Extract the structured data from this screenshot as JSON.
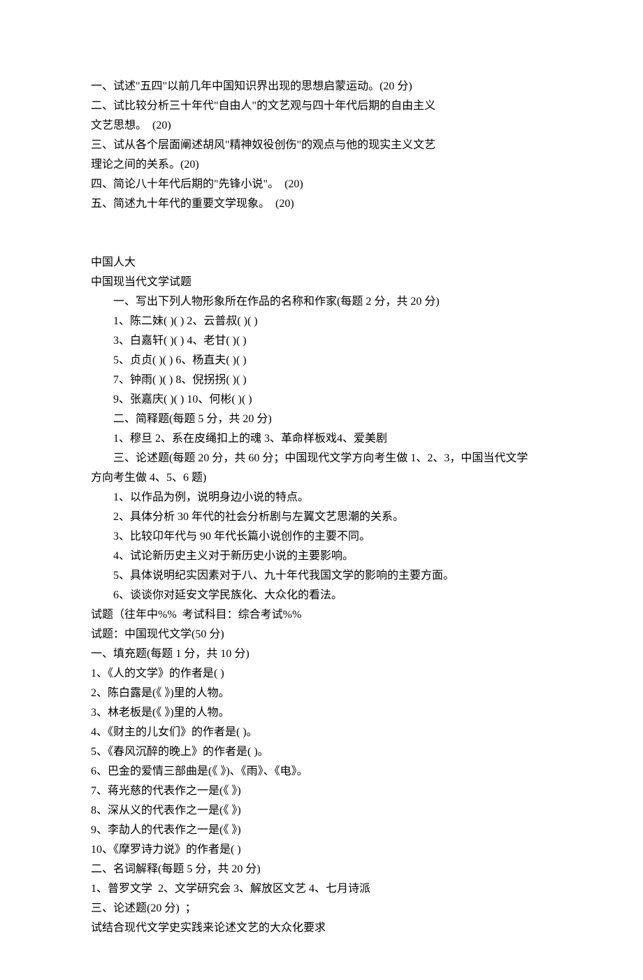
{
  "section1": {
    "q1": "一、试述\"五四\"以前几年中国知识界出现的思想启蒙运动。(20 分)",
    "q2a": "二、试比较分析三十年代\"自由人\"的文艺观与四十年代后期的自由主义",
    "q2b": "文艺思想。  (20)",
    "q3a": "三、试从各个层面阐述胡风\"精神奴役创伤\"的观点与他的现实主义文艺",
    "q3b": "理论之间的关系。(20)",
    "q4": "四、简论八十年代后期的\"先锋小说\"。  (20)",
    "q5": "五、简述九十年代的重要文学现象。  (20)"
  },
  "section2": {
    "univ": "中国人大",
    "title": "中国现当代文学试题",
    "part1_head": "一、写出下列人物形象所在作品的名称和作家(每题 2 分，共 20 分)",
    "p1_1": "1、陈二妹( )( ) 2、云普叔( )( )",
    "p1_2": "3、白嘉轩( )( ) 4、老甘( )( )",
    "p1_3": "5、贞贞( )( ) 6、杨直夫( )( )",
    "p1_4": "7、钟雨( )( ) 8、倪拐拐( )( )",
    "p1_5": "9、张嘉庆( )( ) 10、何彬( )( )",
    "part2_head": "二、简释题(每题 5 分，共 20 分)",
    "p2_1": "1、穆旦 2、系在皮绳扣上的魂 3、革命样板戏4、爱美剧",
    "part3_head_a": "三、论述题(每题 20 分，共 60 分；中国现代文学方向考生做 1、2、3，中国当代文学",
    "part3_head_b": "方向考生做 4、5、6 题)",
    "p3_1": "1、以作品为例，说明身边小说的特点。",
    "p3_2": "2、具体分析 30 年代的社会分析剧与左翼文艺思潮的关系。",
    "p3_3": "3、比较卬年代与 90 年代长篇小说创作的主要不同。",
    "p3_4": "4、试论新历史主义对于新历史小说的主要影响。",
    "p3_5": "5、具体说明纪实因素对于八、九十年代我国文学的影响的主要方面。",
    "p3_6": "6、谈谈你对延安文学民族化、大众化的看法。"
  },
  "section3": {
    "head1": "试题（往年中%%  考试科目：综合考试%%",
    "head2": "试题：中国现代文学(50 分)",
    "part1_head": "一、填充题(每题 1 分，共 10 分)",
    "f1": "1、《人的文学》的作者是( )",
    "f2": "2、陈白露是(《 》)里的人物。",
    "f3": "3、林老板是(《 》)里的人物。",
    "f4": "4、《财主的儿女们》的作者是( )。",
    "f5": "5、《春风沉醉的晚上》的作者是( )。",
    "f6": "6、巴金的爱情三部曲是(《 》)、《雨》、《电》。",
    "f7": "7、蒋光慈的代表作之一是(《 》)",
    "f8": "8、深从义的代表作之一是(《 》)",
    "f9": "9、李劼人的代表作之一是(《 》)",
    "f10": "10、《摩罗诗力说》的作者是( )",
    "part2_head": "二、名词解释(每题 5 分，共 20 分)",
    "n1": "1、普罗文学  2、文学研究会 3、解放区文艺 4、七月诗派",
    "part3_head": "三、论述题(20 分)  ；",
    "e1": "试结合现代文学史实践来论述文艺的大众化要求"
  }
}
